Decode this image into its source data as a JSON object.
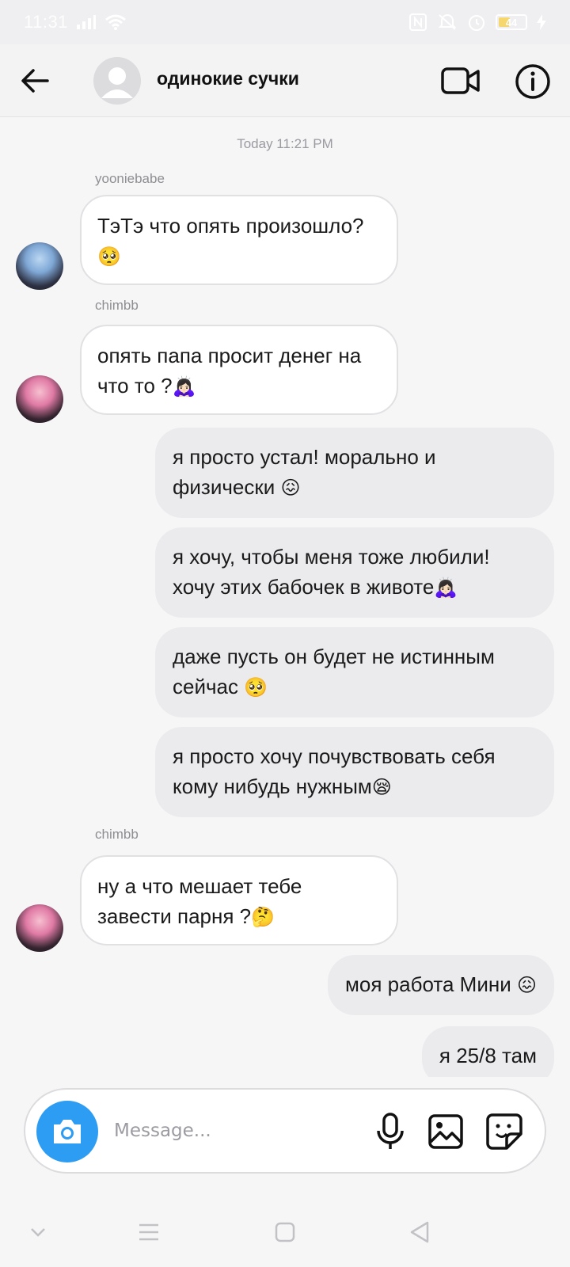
{
  "status_bar": {
    "time": "11:31",
    "battery": "44"
  },
  "header": {
    "title": "одинокие сучки"
  },
  "chat": {
    "timestamp": "Today 11:21 PM",
    "messages": [
      {
        "sender": "yooniebabe",
        "text": "ТэТэ что опять произошло?",
        "emoji": "🥺"
      },
      {
        "sender": "chimbb",
        "text": "опять папа просит денег на что то ?",
        "emoji": "🙇🏻‍♀️"
      },
      {
        "text": "я просто устал! морально и физически ",
        "emoji": "😖"
      },
      {
        "text": "я хочу, чтобы меня тоже любили! хочу этих бабочек в животе",
        "emoji": "🙇🏻‍♀️"
      },
      {
        "text": "даже пусть он будет не истинным сейчас ",
        "emoji": "🥺"
      },
      {
        "text": "я просто хочу почувствовать себя кому нибудь нужным",
        "emoji": "😪"
      },
      {
        "sender": "chimbb",
        "text": "ну а что мешает тебе завести парня ?",
        "emoji": "🤔"
      },
      {
        "text": "моя работа Мини ",
        "emoji": "😖"
      },
      {
        "text": "я 25/8 там"
      }
    ]
  },
  "composer": {
    "placeholder": "Message..."
  },
  "colors": {
    "accent": "#2d9cf3",
    "bubble_out": "#ebebed",
    "bubble_in": "#ffffff"
  }
}
